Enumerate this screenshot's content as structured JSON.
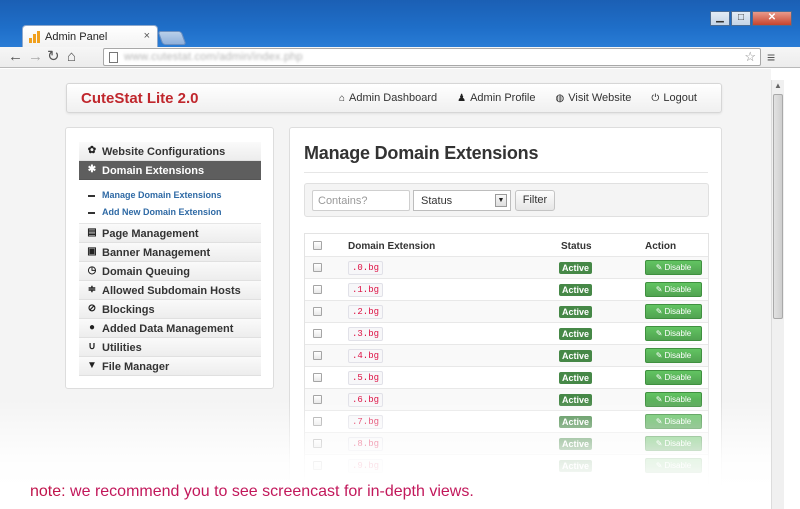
{
  "browser": {
    "tab_title": "Admin Panel",
    "tab_close": "×",
    "url": "www.cutestat.com/admin/index.php",
    "window_buttons": {
      "minimize": "▁",
      "maximize": "□",
      "close": "✕"
    }
  },
  "header": {
    "brand": "CuteStat Lite 2.0",
    "nav": [
      {
        "label": "Admin Dashboard",
        "icon": "home-icon",
        "glyph": "⌂"
      },
      {
        "label": "Admin Profile",
        "icon": "user-icon",
        "glyph": "♟"
      },
      {
        "label": "Visit Website",
        "icon": "globe-icon",
        "glyph": "◍"
      },
      {
        "label": "Logout",
        "icon": "power-icon",
        "glyph": "⏻"
      }
    ]
  },
  "sidebar": {
    "items": [
      {
        "label": "Website Configurations",
        "icon": "gear-icon",
        "glyph": "✿"
      },
      {
        "label": "Domain Extensions",
        "icon": "asterisk-icon",
        "glyph": "✱",
        "active": true
      },
      {
        "label": "Page Management",
        "icon": "file-icon",
        "glyph": "▤"
      },
      {
        "label": "Banner Management",
        "icon": "picture-icon",
        "glyph": "▣"
      },
      {
        "label": "Domain Queuing",
        "icon": "clock-icon",
        "glyph": "◷"
      },
      {
        "label": "Allowed Subdomain Hosts",
        "icon": "tasks-icon",
        "glyph": "≑"
      },
      {
        "label": "Blockings",
        "icon": "ban-icon",
        "glyph": "⊘"
      },
      {
        "label": "Added Data Management",
        "icon": "map-marker-icon",
        "glyph": "●"
      },
      {
        "label": "Utilities",
        "icon": "magnet-icon",
        "glyph": "∪"
      },
      {
        "label": "File Manager",
        "icon": "filter-icon",
        "glyph": "▼"
      }
    ],
    "subitems": [
      {
        "label": "Manage Domain Extensions"
      },
      {
        "label": "Add New Domain Extension"
      }
    ]
  },
  "main": {
    "title": "Manage Domain Extensions",
    "filter": {
      "search_placeholder": "Contains?",
      "status_selected": "Status",
      "filter_label": "Filter"
    },
    "table": {
      "headers": {
        "extension": "Domain Extension",
        "status": "Status",
        "action": "Action"
      },
      "rows": [
        {
          "ext": ".0.bg",
          "status": "Active",
          "action": "Disable"
        },
        {
          "ext": ".1.bg",
          "status": "Active",
          "action": "Disable"
        },
        {
          "ext": ".2.bg",
          "status": "Active",
          "action": "Disable"
        },
        {
          "ext": ".3.bg",
          "status": "Active",
          "action": "Disable"
        },
        {
          "ext": ".4.bg",
          "status": "Active",
          "action": "Disable"
        },
        {
          "ext": ".5.bg",
          "status": "Active",
          "action": "Disable"
        },
        {
          "ext": ".6.bg",
          "status": "Active",
          "action": "Disable"
        },
        {
          "ext": ".7.bg",
          "status": "Active",
          "action": "Disable"
        },
        {
          "ext": ".8.bg",
          "status": "Active",
          "action": "Disable"
        },
        {
          "ext": ".9.bg",
          "status": "Active",
          "action": "Disable"
        }
      ]
    }
  },
  "note": {
    "lead": "note:",
    "text": " we recommend you to see screencast for in-depth views."
  },
  "colors": {
    "brand": "#c0272d",
    "active_badge": "#468847",
    "disable_button": "#5bb75b",
    "note": "#c2185b"
  }
}
